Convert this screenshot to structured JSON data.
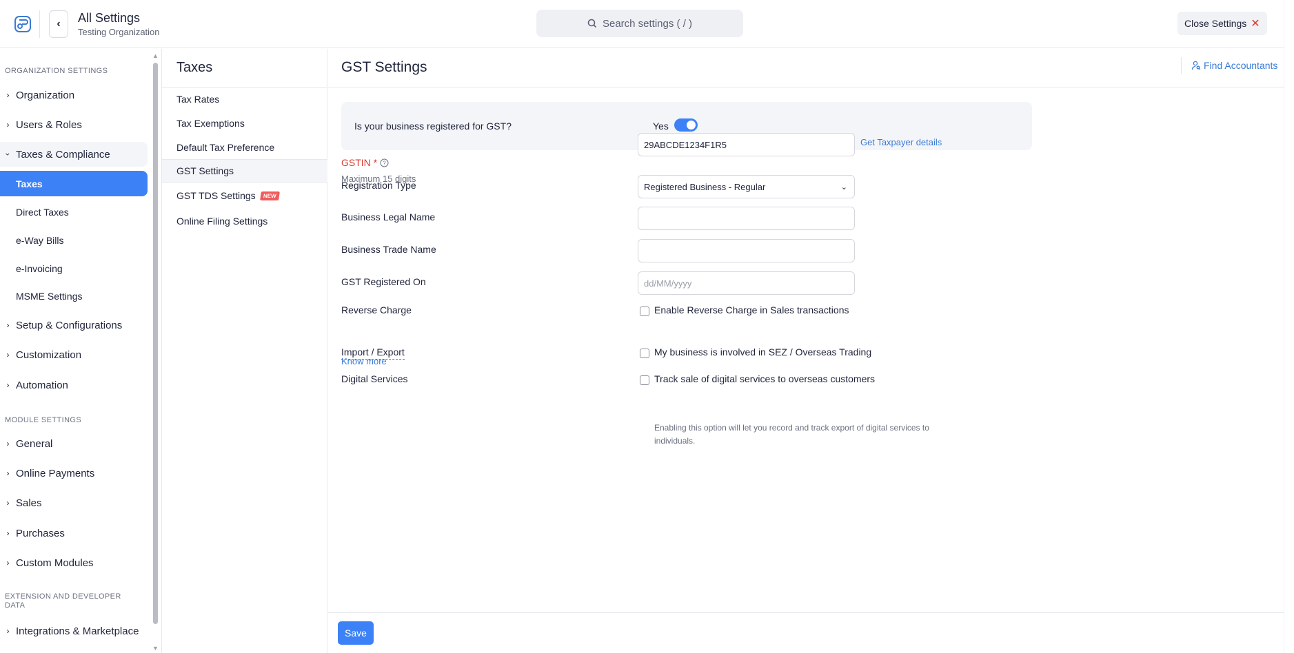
{
  "header": {
    "title": "All Settings",
    "org": "Testing Organization",
    "search_placeholder": "Search settings ( / )",
    "close_label": "Close Settings"
  },
  "sidebar": {
    "section_org": "ORGANIZATION SETTINGS",
    "section_module": "MODULE SETTINGS",
    "section_ext": "EXTENSION AND DEVELOPER DATA",
    "org_items": [
      "Organization",
      "Users & Roles",
      "Taxes & Compliance"
    ],
    "tax_sub_items": [
      "Taxes",
      "Direct Taxes",
      "e-Way Bills",
      "e-Invoicing",
      "MSME Settings"
    ],
    "org_items_after": [
      "Setup & Configurations",
      "Customization",
      "Automation"
    ],
    "module_items": [
      "General",
      "Online Payments",
      "Sales",
      "Purchases",
      "Custom Modules"
    ],
    "ext_items": [
      "Integrations & Marketplace"
    ]
  },
  "midpanel": {
    "title": "Taxes",
    "items": [
      "Tax Rates",
      "Tax Exemptions",
      "Default Tax Preference",
      "GST Settings",
      "GST TDS Settings",
      "Online Filing Settings"
    ],
    "new_badge": "NEW"
  },
  "main": {
    "title": "GST Settings",
    "find_accountants": "Find Accountants",
    "gst_question": "Is your business registered for GST?",
    "gst_answer": "Yes",
    "gst_registered": true,
    "gstin_label": "GSTIN *",
    "gstin_value": "29ABCDE1234F1R5",
    "gstin_hint": "Maximum 15 digits",
    "get_taxpayer": "Get Taxpayer details",
    "reg_type_label": "Registration Type",
    "reg_type_value": "Registered Business - Regular",
    "legal_name_label": "Business Legal Name",
    "legal_name_value": "",
    "trade_name_label": "Business Trade Name",
    "trade_name_value": "",
    "reg_on_label": "GST Registered On",
    "reg_on_placeholder": "dd/MM/yyyy",
    "reverse_label": "Reverse Charge",
    "know_more": "Know more",
    "reverse_chk": "Enable Reverse Charge in Sales transactions",
    "import_label": "Import / Export",
    "import_chk": "My business is involved in SEZ / Overseas Trading",
    "digital_label": "Digital Services",
    "digital_chk": "Track sale of digital services to overseas customers",
    "digital_desc": "Enabling this option will let you record and track export of digital services to individuals.",
    "save_label": "Save"
  },
  "colors": {
    "accent": "#3c82f6",
    "link": "#3a7bd5",
    "required": "#d63a2f"
  }
}
